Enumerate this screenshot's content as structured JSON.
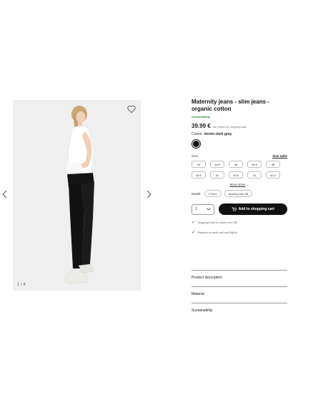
{
  "gallery": {
    "counter": "1 / 4",
    "prev_icon": "chevron-left-icon",
    "next_icon": "chevron-right-icon",
    "wishlist_icon": "heart-icon"
  },
  "product": {
    "title": "Maternity jeans - slim jeans - organic cotton",
    "sustainability_tag": "Sustainability",
    "price": "39.99 €",
    "price_note": "Incl. taxes excl. shipping costs",
    "colour_label": "Colour:",
    "colour_value": "denim-dark gray",
    "colour_swatch": "#111111",
    "size_label": "Size:",
    "size_table_link": "Size table",
    "sizes": [
      "34",
      "34.5",
      "36",
      "36.5",
      "38",
      "38.5",
      "40",
      "40.5",
      "42",
      "42.5"
    ],
    "more_sizes": "More sizes",
    "model_label": "Model:",
    "model_height": "174cm",
    "model_size": "wearing size 38"
  },
  "buy": {
    "quantity": "1",
    "cart_label": "Add to shopping cart",
    "cart_icon": "cart-icon"
  },
  "benefits": [
    "Shipping is free for orders over 19€",
    "Payment by credit card and PayPal"
  ],
  "accordion": {
    "description": "Product description",
    "material": "Material",
    "sustainability": "Sustainability"
  }
}
